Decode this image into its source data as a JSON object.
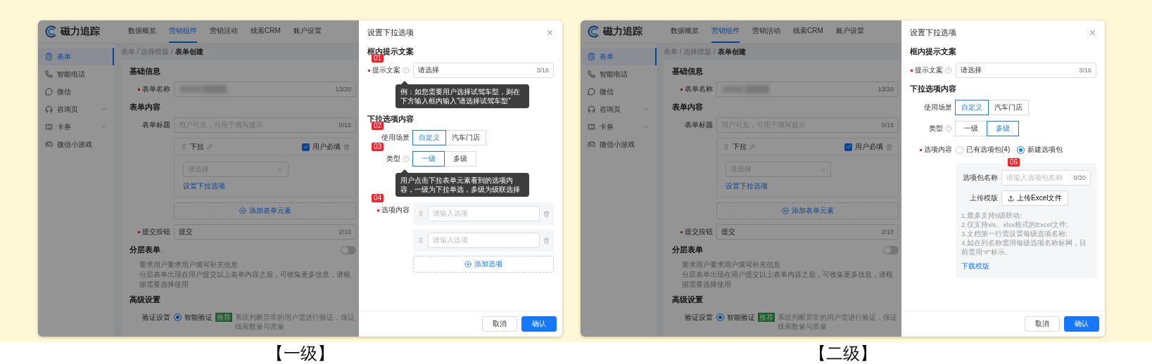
{
  "panels": [
    {
      "caption": "【一级】",
      "app": {
        "logo": "磁力追踪",
        "nav": [
          {
            "label": "数据概览",
            "selected": false
          },
          {
            "label": "营销组件",
            "selected": true
          },
          {
            "label": "营销活动",
            "selected": false
          },
          {
            "label": "线索CRM",
            "selected": false
          },
          {
            "label": "账户设置",
            "selected": false
          }
        ],
        "sidebar": [
          {
            "label": "表单",
            "selected": true,
            "expandable": false
          },
          {
            "label": "智能电话",
            "selected": false,
            "expandable": false
          },
          {
            "label": "微信",
            "selected": false,
            "expandable": false
          },
          {
            "label": "咨询页",
            "selected": false,
            "expandable": true
          },
          {
            "label": "卡券",
            "selected": false,
            "expandable": true
          },
          {
            "label": "微信小游戏",
            "selected": false,
            "expandable": false
          }
        ],
        "breadcrumb": "表单 / 选择模版 / **表单创建**",
        "sections": [
          {
            "title": "基础信息",
            "rows": [
              {
                "kind": "input",
                "label": "表单名称",
                "required": true,
                "redacted": true,
                "counter": "13/20"
              }
            ]
          },
          {
            "title": "表单内容",
            "rows": [
              {
                "kind": "input",
                "label": "表单标题",
                "required": false,
                "placeholder": "用户可见，可用于填写提示",
                "counter": "0/15"
              },
              {
                "kind": "element",
                "name": "下拉",
                "check_label": "用户必填",
                "checked": true,
                "select_placeholder": "请选择",
                "link": "设置下拉选项"
              },
              {
                "kind": "add",
                "label": "添加表单元素"
              },
              {
                "kind": "input",
                "label": "提交按钮",
                "required": true,
                "value": "提交",
                "counter": "2/10"
              }
            ]
          },
          {
            "title": "分层表单",
            "toggle": {
              "on": false
            },
            "description": [
              "要求用户要求用户填写补充信息",
              "分层表单出现在用户提交以上表单内容之后，可收集更多信息，请根据需要选择使用"
            ]
          },
          {
            "title": "高级设置",
            "rows": [
              {
                "kind": "radio",
                "label": "验证设置",
                "option": "智能验证",
                "selected": true,
                "tag": "推荐",
                "hint": "系统判断异常的用户需进行验证，保证线索数量与质量"
              }
            ]
          }
        ]
      },
      "drawer": {
        "title": "设置下拉选项",
        "sections": [
          {
            "title": "框内提示文案",
            "rows": [
              {
                "kind": "input",
                "label": "提示文案",
                "required": true,
                "help": true,
                "badge": "01",
                "value": "请选择",
                "counter": "3/16",
                "tooltip": "例：如您需要用户选择试驾车型，则在下方输入框内输入“请选择试驾车型”"
              }
            ]
          },
          {
            "title": "下拉选项内容",
            "rows": [
              {
                "kind": "segmented",
                "label": "使用场景",
                "required": false,
                "help": false,
                "badge": "02",
                "options": [
                  {
                    "label": "自定义",
                    "selected": true
                  },
                  {
                    "label": "汽车门店",
                    "selected": false
                  }
                ]
              },
              {
                "kind": "segmented",
                "label": "类型",
                "required": false,
                "help": true,
                "badge": "03",
                "tooltip": "用户点击下拉表单元素看到的选项内容，一级为下拉单选，多级为级联选择",
                "options": [
                  {
                    "label": "一级",
                    "selected": true
                  },
                  {
                    "label": "多级",
                    "selected": false
                  }
                ]
              },
              {
                "kind": "option_list",
                "label": "选项内容",
                "required": true,
                "help": false,
                "badge": "04",
                "items": [
                  {
                    "placeholder": "请输入选项"
                  },
                  {
                    "placeholder": "请输入选项"
                  }
                ],
                "add": "添加选项"
              }
            ]
          }
        ],
        "buttons": [
          {
            "label": "取消",
            "kind": "default"
          },
          {
            "label": "确认",
            "kind": "primary"
          }
        ]
      }
    },
    {
      "caption": "【二级】",
      "app": {
        "logo": "磁力追踪",
        "nav": [
          {
            "label": "数据概览",
            "selected": false
          },
          {
            "label": "营销组件",
            "selected": true
          },
          {
            "label": "营销活动",
            "selected": false
          },
          {
            "label": "线索CRM",
            "selected": false
          },
          {
            "label": "账户设置",
            "selected": false
          }
        ],
        "sidebar": [
          {
            "label": "表单",
            "selected": true,
            "expandable": false
          },
          {
            "label": "智能电话",
            "selected": false,
            "expandable": false
          },
          {
            "label": "微信",
            "selected": false,
            "expandable": false
          },
          {
            "label": "咨询页",
            "selected": false,
            "expandable": true
          },
          {
            "label": "卡券",
            "selected": false,
            "expandable": true
          },
          {
            "label": "微信小游戏",
            "selected": false,
            "expandable": false
          }
        ],
        "breadcrumb": "表单 / 选择模版 / **表单创建**",
        "sections": [
          {
            "title": "基础信息",
            "rows": [
              {
                "kind": "input",
                "label": "表单名称",
                "required": true,
                "redacted": true,
                "counter": "13/20"
              }
            ]
          },
          {
            "title": "表单内容",
            "rows": [
              {
                "kind": "input",
                "label": "表单标题",
                "required": false,
                "placeholder": "用户可见，可用于填写提示",
                "counter": "0/15"
              },
              {
                "kind": "element",
                "name": "下拉",
                "check_label": "用户必填",
                "checked": true,
                "select_placeholder": "请选择",
                "link": "设置下拉选项"
              },
              {
                "kind": "add",
                "label": "添加表单元素"
              },
              {
                "kind": "input",
                "label": "提交按钮",
                "required": true,
                "value": "提交",
                "counter": "2/10"
              }
            ]
          },
          {
            "title": "分层表单",
            "toggle": {
              "on": false
            },
            "description": [
              "要求用户要求用户填写补充信息",
              "分层表单出现在用户提交以上表单内容之后，可收集更多信息，请根据需要选择使用"
            ]
          },
          {
            "title": "高级设置",
            "rows": [
              {
                "kind": "radio",
                "label": "验证设置",
                "option": "智能验证",
                "selected": true,
                "tag": "推荐",
                "hint": "系统判断异常的用户需进行验证，保证线索数量与质量"
              }
            ]
          }
        ]
      },
      "drawer": {
        "title": "设置下拉选项",
        "sections": [
          {
            "title": "框内提示文案",
            "rows": [
              {
                "kind": "input",
                "label": "提示文案",
                "required": true,
                "help": true,
                "value": "请选择",
                "counter": "3/16"
              }
            ]
          },
          {
            "title": "下拉选项内容",
            "rows": [
              {
                "kind": "segmented",
                "label": "使用场景",
                "required": false,
                "help": false,
                "options": [
                  {
                    "label": "自定义",
                    "selected": true
                  },
                  {
                    "label": "汽车门店",
                    "selected": false
                  }
                ]
              },
              {
                "kind": "segmented",
                "label": "类型",
                "required": false,
                "help": true,
                "options": [
                  {
                    "label": "一级",
                    "selected": false
                  },
                  {
                    "label": "多级",
                    "selected": true
                  }
                ]
              },
              {
                "kind": "package",
                "label": "选项内容",
                "required": true,
                "help": false,
                "radios": [
                  {
                    "label": "已有选项包(4)",
                    "selected": false
                  },
                  {
                    "label": "新建选项包",
                    "selected": true
                  }
                ],
                "package": {
                  "badge": "06",
                  "name_label": "选项包名称",
                  "name_placeholder": "请输入选项包名称",
                  "counter": "0/20",
                  "upload_label": "上传模版",
                  "upload_button": "上传Excel文件",
                  "notes": [
                    "1.最多支持5级联动;",
                    "2.仅支持xls、xlsx格式的Excel文件;",
                    "3.文档第一行需设置每级选项名称;",
                    "4.如在列名称需用每级选项名称标网，目前需用“#”标示。"
                  ],
                  "link": "下载模版"
                }
              }
            ]
          }
        ],
        "buttons": [
          {
            "label": "取消",
            "kind": "default"
          },
          {
            "label": "确认",
            "kind": "primary"
          }
        ]
      }
    }
  ]
}
